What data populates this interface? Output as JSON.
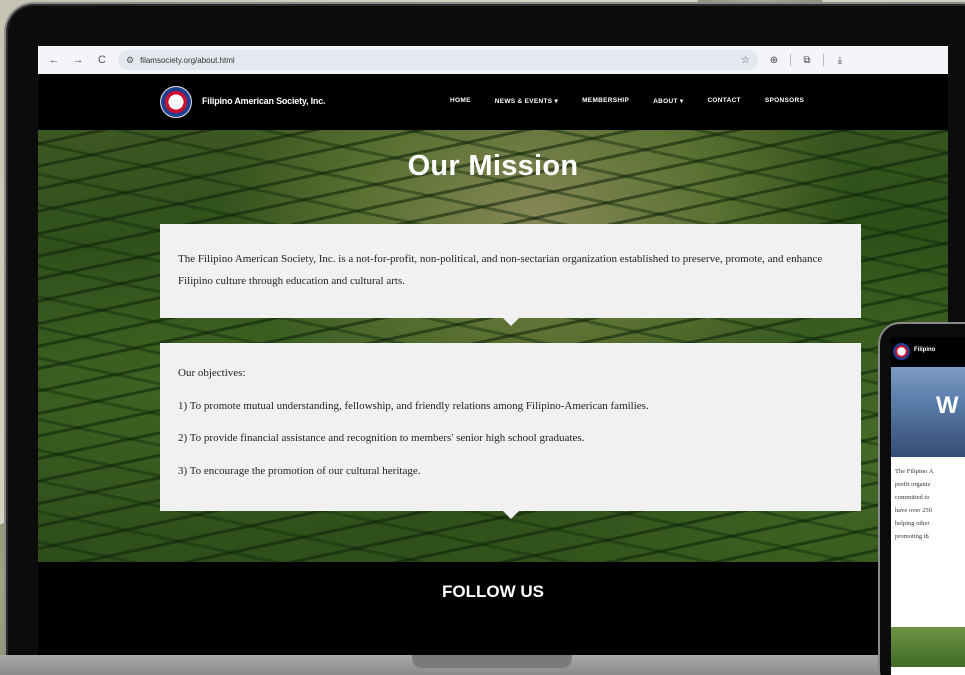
{
  "browser": {
    "nav_back": "←",
    "nav_forward": "→",
    "nav_reload": "C",
    "tune_icon": "⚙",
    "url": "filamsociety.org/about.html",
    "star_icon": "☆",
    "extensions_icon": "⊕",
    "tabs_icon": "⧉",
    "download_icon": "⤓"
  },
  "site": {
    "brand": "Filipino American Society, Inc.",
    "nav": [
      "HOME",
      "NEWS & EVENTS ▾",
      "MEMBERSHIP",
      "ABOUT ▾",
      "CONTACT",
      "SPONSORS"
    ]
  },
  "hero": {
    "title": "Our Mission",
    "mission_text": "The Filipino American Society, Inc. is a not-for-profit, non-political, and non-sectarian organization established to preserve, promote, and enhance Filipino culture through education and cultural arts.",
    "objectives_intro": "Our objectives:",
    "objectives": [
      "1) To promote mutual understanding, fellowship, and friendly relations among Filipino-American families.",
      "2) To provide financial assistance and recognition to members' senior high school graduates.",
      "3) To encourage the promotion of our cultural heritage."
    ]
  },
  "follow": {
    "title": "FOLLOW US"
  },
  "phone": {
    "brand": "Filipino",
    "hero_title": "W",
    "text_lines": [
      "The Filipino A",
      "profit organiz",
      "committed to",
      "have over 250",
      "helping other",
      "promoting th"
    ]
  }
}
